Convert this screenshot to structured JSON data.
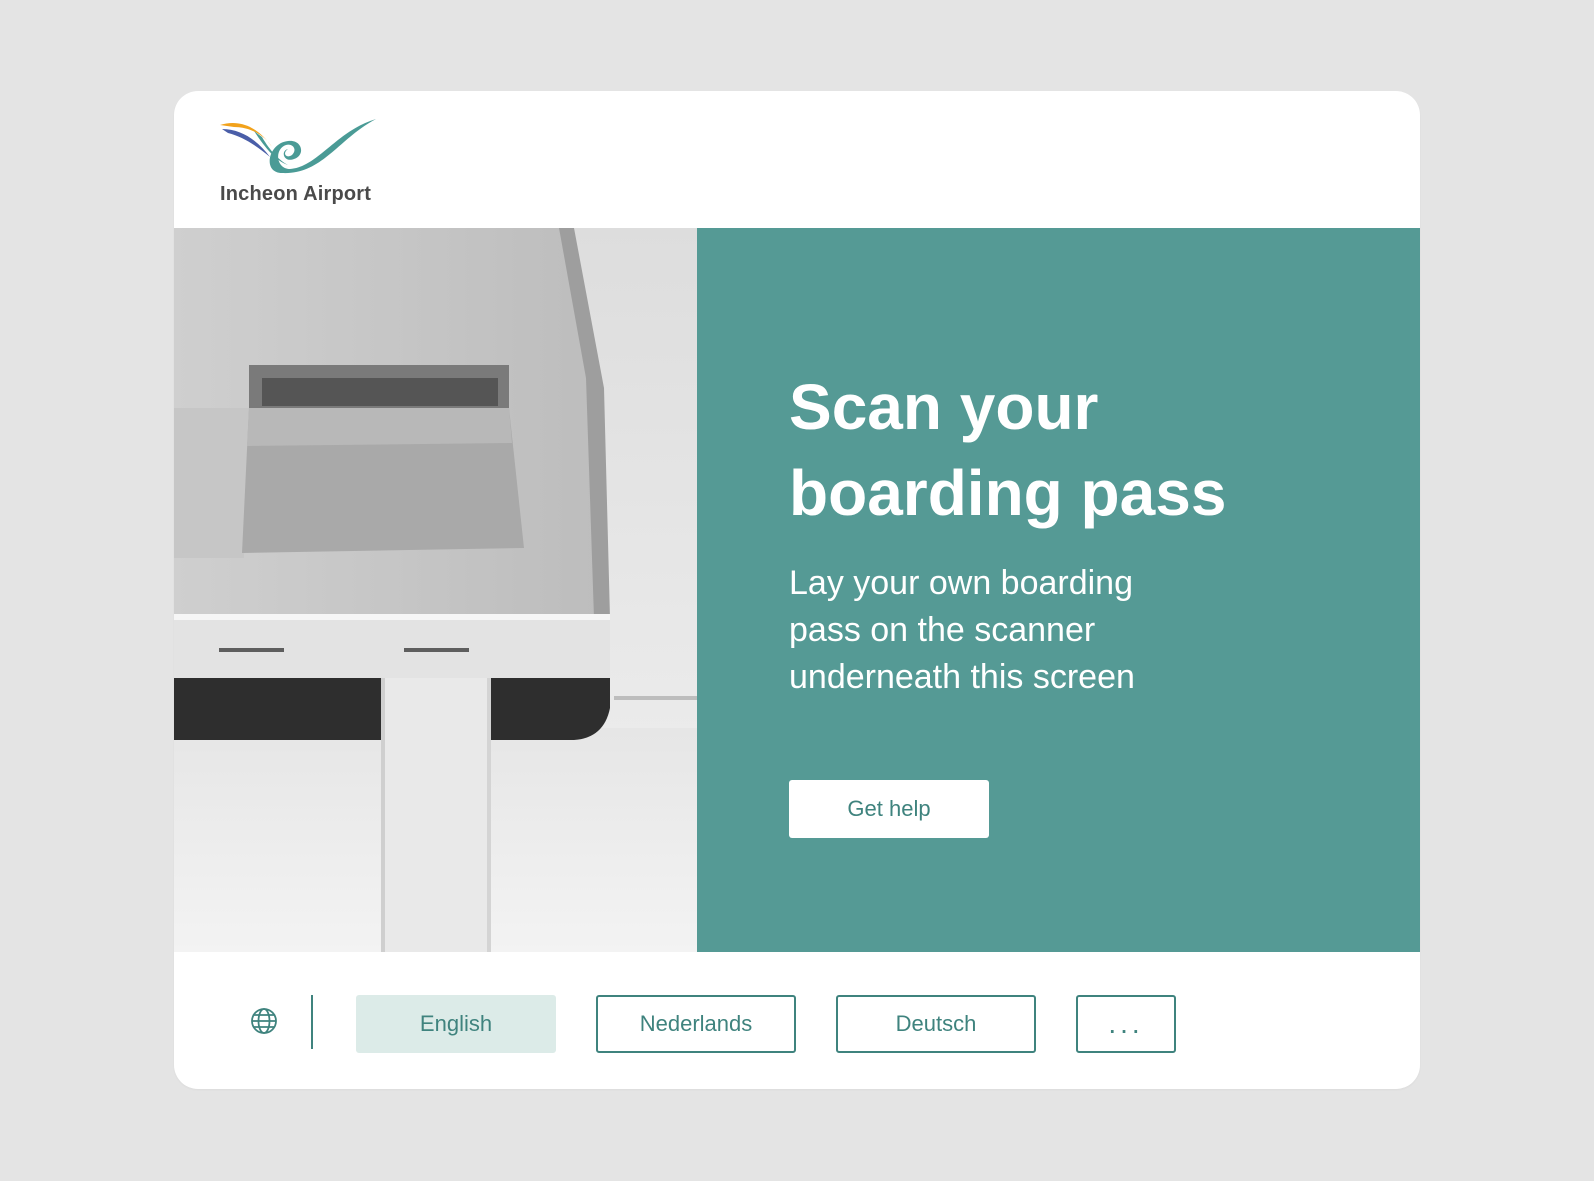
{
  "brand": {
    "name": "Incheon Airport",
    "accent": "#559a95",
    "accent_dark": "#3f837e",
    "logo_orange": "#f2a21b",
    "logo_blue": "#4a5ea8"
  },
  "hero": {
    "title": "Scan your boarding pass",
    "subtitle": "Lay your own boarding pass on the scanner underneath this screen",
    "help_button": "Get help"
  },
  "language_bar": {
    "icon": "globe-icon",
    "selected": "English",
    "options": [
      "English",
      "Nederlands",
      "Deutsch"
    ],
    "more_label": "..."
  }
}
